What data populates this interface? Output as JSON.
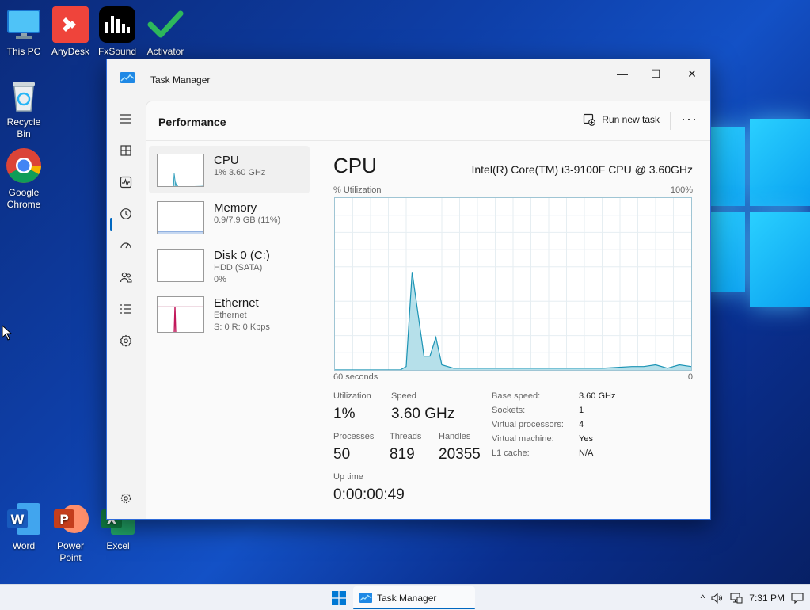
{
  "desktop": {
    "icons": [
      {
        "label": "This PC"
      },
      {
        "label": "AnyDesk"
      },
      {
        "label": "FxSound"
      },
      {
        "label": "Activator"
      },
      {
        "label": "Recycle Bin"
      },
      {
        "label": "Google Chrome"
      },
      {
        "label": "Word"
      },
      {
        "label": "Power Point"
      },
      {
        "label": "Excel"
      }
    ]
  },
  "window": {
    "title": "Task Manager",
    "controls": {
      "minimize": "—",
      "maximize": "☐",
      "close": "✕"
    }
  },
  "sidebar": {
    "items": [
      {
        "icon": "hamburger-menu-icon"
      },
      {
        "icon": "processes-icon"
      },
      {
        "icon": "performance-icon",
        "active": true
      },
      {
        "icon": "app-history-icon"
      },
      {
        "icon": "startup-apps-icon"
      },
      {
        "icon": "users-icon"
      },
      {
        "icon": "details-icon"
      },
      {
        "icon": "services-icon"
      },
      {
        "icon": "settings-icon"
      }
    ]
  },
  "header": {
    "title": "Performance",
    "run_new_task": "Run new task",
    "more": "···"
  },
  "perf_list": [
    {
      "name": "CPU",
      "sub1": "1% 3.60 GHz",
      "sub2": "",
      "selected": true
    },
    {
      "name": "Memory",
      "sub1": "0.9/7.9 GB (11%)",
      "sub2": ""
    },
    {
      "name": "Disk 0 (C:)",
      "sub1": "HDD (SATA)",
      "sub2": "0%"
    },
    {
      "name": "Ethernet",
      "sub1": "Ethernet",
      "sub2": "S: 0 R: 0 Kbps"
    }
  ],
  "detail": {
    "title": "CPU",
    "model": "Intel(R) Core(TM) i3-9100F CPU @ 3.60GHz",
    "graph_ylabel": "% Utilization",
    "graph_ymax": "100%",
    "graph_xlabel": "60 seconds",
    "graph_xmin": "0",
    "stats": {
      "utilization_label": "Utilization",
      "utilization": "1%",
      "speed_label": "Speed",
      "speed": "3.60 GHz",
      "processes_label": "Processes",
      "processes": "50",
      "threads_label": "Threads",
      "threads": "819",
      "handles_label": "Handles",
      "handles": "20355",
      "uptime_label": "Up time",
      "uptime": "0:00:00:49"
    },
    "specs": {
      "base_speed_label": "Base speed:",
      "base_speed": "3.60 GHz",
      "sockets_label": "Sockets:",
      "sockets": "1",
      "virtual_processors_label": "Virtual processors:",
      "virtual_processors": "4",
      "virtual_machine_label": "Virtual machine:",
      "virtual_machine": "Yes",
      "l1_cache_label": "L1 cache:",
      "l1_cache": "N/A"
    }
  },
  "chart_data": {
    "type": "area",
    "x": [
      60,
      57,
      54,
      51,
      49,
      48,
      47,
      45,
      44,
      43,
      42,
      41,
      40,
      38,
      35,
      30,
      25,
      20,
      15,
      10,
      8,
      6,
      4,
      2,
      0
    ],
    "values": [
      0,
      0,
      0,
      0,
      0,
      2,
      57,
      8,
      8,
      19,
      3,
      2,
      1,
      1,
      1,
      1,
      1,
      1,
      1,
      2,
      2,
      3,
      1,
      3,
      2
    ],
    "ylim": [
      0,
      100
    ],
    "xlim": [
      60,
      0
    ],
    "xlabel": "60 seconds",
    "ylabel": "% Utilization",
    "grid": true,
    "fill_color": "#b6e0ea",
    "line_color": "#1a93b4"
  },
  "taskbar": {
    "active_app": "Task Manager",
    "time": "7:31 PM",
    "tray_chevron": "^"
  },
  "colors": {
    "accent": "#0067c0",
    "graph_line": "#1a93b4",
    "ethernet_line": "#c2185b"
  }
}
